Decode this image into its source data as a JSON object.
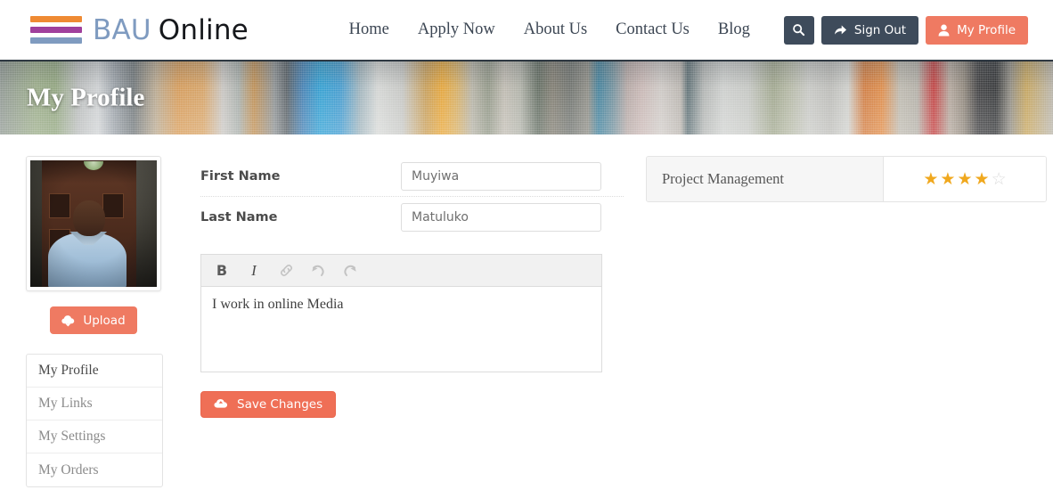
{
  "header": {
    "logo": {
      "bars": [
        "#ef8a33",
        "#a0409c",
        "#7f9bc0"
      ],
      "text_primary": "BAU",
      "text_secondary": "Online"
    },
    "nav": [
      {
        "label": "Home",
        "name": "nav-home"
      },
      {
        "label": "Apply Now",
        "name": "nav-apply-now"
      },
      {
        "label": "About Us",
        "name": "nav-about-us"
      },
      {
        "label": "Contact Us",
        "name": "nav-contact-us"
      },
      {
        "label": "Blog",
        "name": "nav-blog"
      }
    ],
    "search_icon": "search-icon",
    "sign_out": {
      "label": "Sign Out",
      "icon": "share-arrow-icon"
    },
    "my_profile": {
      "label": "My Profile",
      "icon": "user-icon"
    }
  },
  "banner": {
    "title": "My Profile"
  },
  "profile": {
    "avatar_alt": "profile-photo",
    "upload_button": {
      "label": "Upload",
      "icon": "cloud-upload-icon"
    },
    "menu": [
      {
        "label": "My Profile",
        "active": true
      },
      {
        "label": "My Links",
        "active": false
      },
      {
        "label": "My Settings",
        "active": false
      },
      {
        "label": "My Orders",
        "active": false
      }
    ]
  },
  "form": {
    "first_name": {
      "label": "First Name",
      "value": "Muyiwa",
      "placeholder": "First Name"
    },
    "last_name": {
      "label": "Last Name",
      "value": "Matuluko",
      "placeholder": "Last Name"
    },
    "editor": {
      "toolbar": [
        {
          "name": "bold-icon",
          "glyph": "B"
        },
        {
          "name": "italic-icon",
          "glyph": "I"
        },
        {
          "name": "link-icon",
          "glyph": "link"
        },
        {
          "name": "undo-icon",
          "glyph": "undo"
        },
        {
          "name": "redo-icon",
          "glyph": "redo"
        }
      ],
      "content": "I work in online Media"
    },
    "save_button": {
      "label": "Save Changes",
      "icon": "cloud-upload-icon"
    }
  },
  "skills": [
    {
      "name": "Project Management",
      "rating": 4,
      "max_rating": 5
    }
  ],
  "colors": {
    "accent_coral": "#ef7a62",
    "dark_slate": "#3e4b5b",
    "star_gold": "#f0a81e",
    "star_empty": "#dcdcdc"
  }
}
